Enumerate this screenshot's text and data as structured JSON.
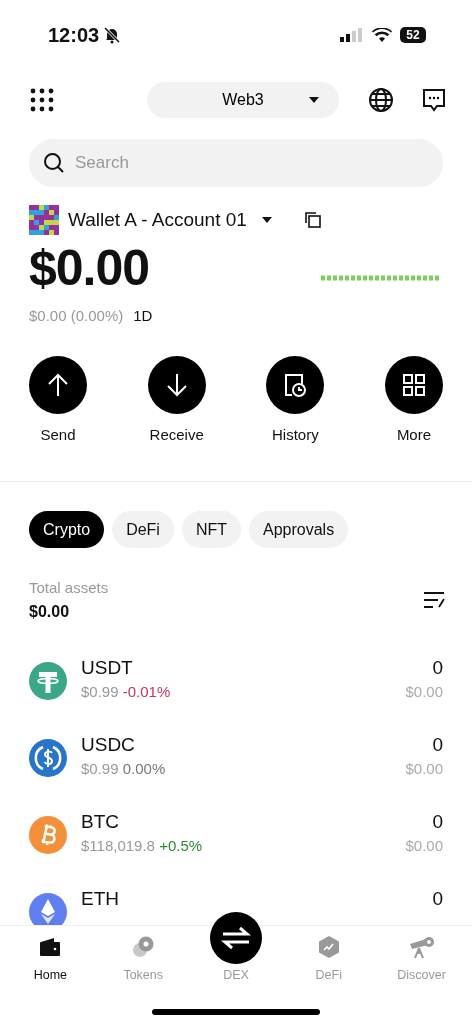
{
  "status_bar": {
    "time": "12:03",
    "battery": "52"
  },
  "header": {
    "network": "Web3"
  },
  "search": {
    "placeholder": "Search"
  },
  "account": {
    "name": "Wallet A - Account 01"
  },
  "balance": {
    "amount": "$0.00",
    "change": "$0.00 (0.00%)",
    "period": "1D"
  },
  "actions": [
    {
      "label": "Send",
      "kind": "send"
    },
    {
      "label": "Receive",
      "kind": "receive"
    },
    {
      "label": "History",
      "kind": "history"
    },
    {
      "label": "More",
      "kind": "more"
    }
  ],
  "tabs": [
    {
      "label": "Crypto",
      "selected": true
    },
    {
      "label": "DeFi",
      "selected": false
    },
    {
      "label": "NFT",
      "selected": false
    },
    {
      "label": "Approvals",
      "selected": false
    }
  ],
  "total": {
    "label": "Total assets",
    "amount": "$0.00"
  },
  "tokens": [
    {
      "symbol": "USDT",
      "kind": "tether",
      "price": "$0.99",
      "change": "-0.01%",
      "color": "#c4365a",
      "amount": "0",
      "value": "$0.00"
    },
    {
      "symbol": "USDC",
      "kind": "usdc",
      "price": "$0.99",
      "change": "0.00%",
      "color": "#777777",
      "amount": "0",
      "value": "$0.00"
    },
    {
      "symbol": "BTC",
      "kind": "btc",
      "price": "$118,019.8",
      "change": "+0.5%",
      "color": "#2e8b2e",
      "amount": "0",
      "value": "$0.00"
    },
    {
      "symbol": "ETH",
      "kind": "eth",
      "amount": "0"
    }
  ],
  "nav": [
    {
      "label": "Home",
      "kind": "wallet",
      "selected": true
    },
    {
      "label": "Tokens",
      "kind": "coins",
      "selected": false
    },
    {
      "label": "DEX",
      "kind": "swap",
      "selected": false
    },
    {
      "label": "DeFi",
      "kind": "hexagon",
      "selected": false
    },
    {
      "label": "Discover",
      "kind": "telescope",
      "selected": false
    }
  ]
}
